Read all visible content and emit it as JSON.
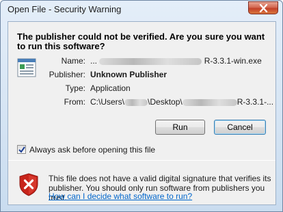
{
  "window": {
    "title": "Open File - Security Warning"
  },
  "dialog": {
    "headline": "The publisher could not be verified.  Are you sure you want to run this software?",
    "fields": {
      "name_label": "Name:",
      "name_prefix": "...",
      "name_suffix": "R-3.3.1-win.exe",
      "publisher_label": "Publisher:",
      "publisher_value": "Unknown Publisher",
      "type_label": "Type:",
      "type_value": "Application",
      "from_label": "From:",
      "from_prefix": "C:\\Users\\",
      "from_middle": "\\Desktop\\",
      "from_suffix": "R-3.3.1-..."
    },
    "run_button": "Run",
    "cancel_button": "Cancel",
    "always_ask_label": "Always ask before opening this file",
    "always_ask_checked": true,
    "warning_text": "This file does not have a valid digital signature that verifies its publisher.  You should only run software from publishers you trust.",
    "help_link": "How can I decide what software to run?"
  },
  "icons": {
    "close": "close-icon",
    "file": "application-file-icon",
    "shield": "security-shield-error-icon",
    "check": "checkmark-icon"
  },
  "colors": {
    "link": "#0066cc",
    "shield_red": "#c8241b",
    "close_red": "#c3412a"
  }
}
